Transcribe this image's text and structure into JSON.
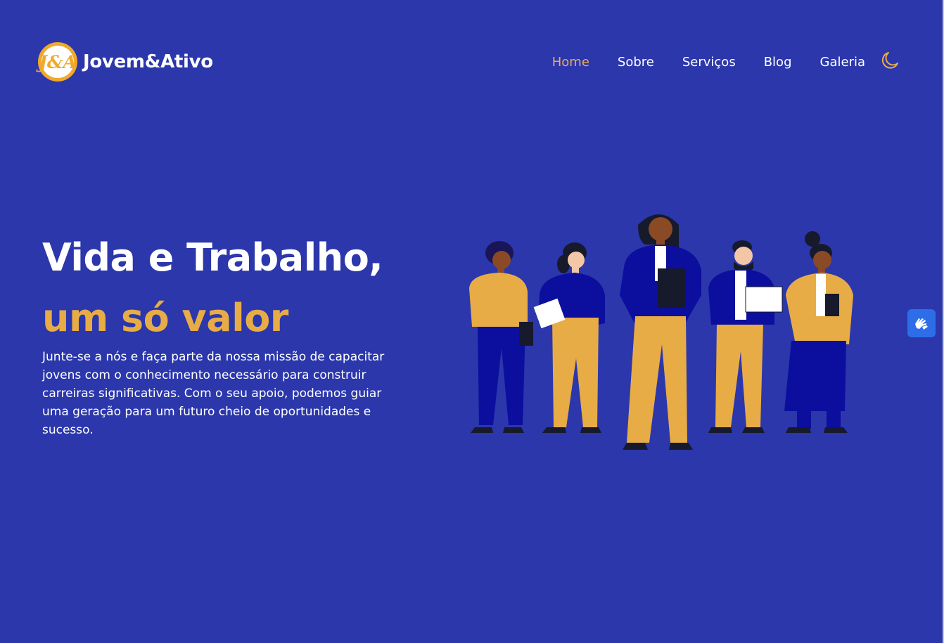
{
  "brand": {
    "logo_text": "J&A",
    "name": "Jovem&Ativo"
  },
  "nav": [
    {
      "label": "Home",
      "active": true
    },
    {
      "label": "Sobre"
    },
    {
      "label": "Serviços"
    },
    {
      "label": "Blog"
    },
    {
      "label": "Galeria"
    }
  ],
  "theme_toggle_icon": "moon-icon",
  "hero": {
    "title_line1": "Vida e Trabalho,",
    "title_line2": "um só valor",
    "description": "Junte-se a nós e faça parte da nossa missão de capacitar jovens com o conhecimento necessário para construir carreiras significativas. Com o seu apoio, podemos guiar uma geração para um futuro cheio de oportunidades e sucesso.",
    "illustration_icon": "team-illustration"
  },
  "accessibility_widget_icon": "sign-language-icon",
  "colors": {
    "background": "#2b37ab",
    "accent": "#e8ac47",
    "nav_active": "#f0ad4e",
    "widget": "#2d6ee8"
  }
}
